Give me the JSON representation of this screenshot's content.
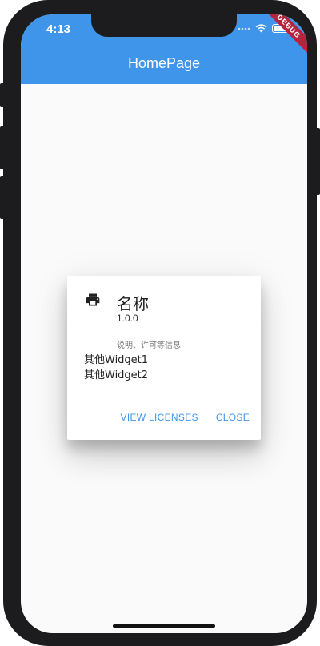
{
  "status_bar": {
    "time": "4:13",
    "icons": [
      "signal-dots-icon",
      "wifi-icon",
      "battery-icon"
    ]
  },
  "debug_banner": {
    "label": "DEBUG"
  },
  "app_bar": {
    "title": "HomePage",
    "color": "#3f95ea"
  },
  "dialog": {
    "icon": "print-icon",
    "app_name": "名称",
    "version": "1.0.0",
    "legalese": "说明、许可等信息",
    "children": [
      "其他Widget1",
      "其他Widget2"
    ],
    "actions": {
      "view_licenses": "VIEW LICENSES",
      "close": "CLOSE"
    }
  },
  "colors": {
    "accent": "#3f95ea",
    "background": "#fafafa",
    "debug": "#b4253c"
  }
}
